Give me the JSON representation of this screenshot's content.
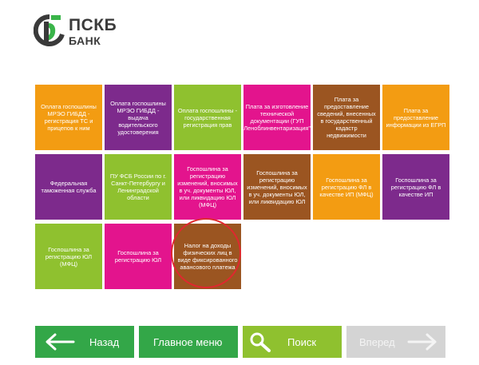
{
  "brand": {
    "name": "ПСКБ",
    "subtitle": "БАНК"
  },
  "tiles": [
    "Оплата госпошлины МРЭО ГИБДД - регистрация ТС и прицепов к ним",
    "Оплата госпошлины МРЭО ГИБДД - выдача водительского удостоверения",
    "Оплата госпошлины - государственная регистрация прав",
    "Плата за изготовление технической документации (ГУП \"Леноблинвентаризация\")",
    "Плата за предоставление сведений, внесенных в государственный кадастр недвижимости",
    "Плата за предоставление информации из ЕГРП",
    "Федеральная таможенная служба",
    "ПУ ФСБ России по г. Санкт-Петербургу и Ленинградской области",
    "Госпошлина за регистрацию изменений, вносимых в уч. документы ЮЛ, или ликвидацию ЮЛ (МФЦ)",
    "Госпошлина за регистрацию изменений, вносимых в уч. документы ЮЛ, или ликвидацию ЮЛ",
    "Госпошлина за регистрацию ФЛ в качестве ИП (МФЦ)",
    "Госпошлина за регистрацию ФЛ в качестве ИП",
    "Госпошлина за регистрацию ЮЛ (МФЦ)",
    "Госпошлина за регистрацию ЮЛ",
    "Налог на доходы физических лиц в виде фиксированного авансового платежа"
  ],
  "nav": {
    "back": "Назад",
    "home": "Главное меню",
    "search": "Поиск",
    "forward": "Вперед"
  },
  "colors": {
    "orange": "#f39c12",
    "purple": "#7d2a8c",
    "green": "#8fc12f",
    "pink": "#e3148d",
    "brown": "#9b5521",
    "nav_green": "#33a748",
    "disabled": "#d4d4d4",
    "highlight": "#e0282e"
  }
}
